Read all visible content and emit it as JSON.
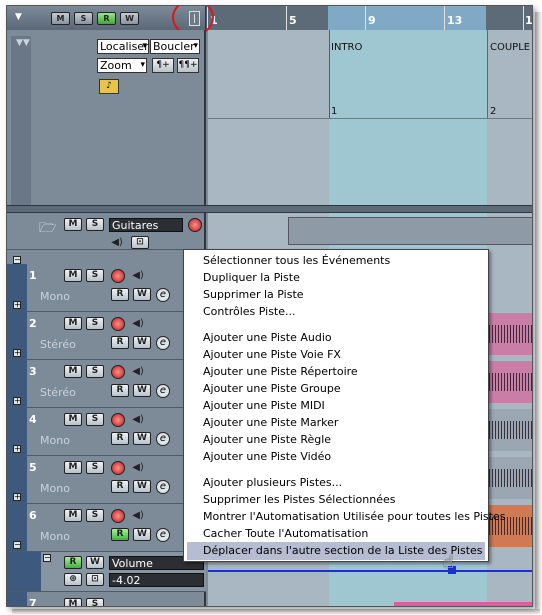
{
  "toolbar": {
    "buttons": [
      {
        "label": "M",
        "on": false
      },
      {
        "label": "S",
        "on": false
      },
      {
        "label": "R",
        "on": true
      },
      {
        "label": "W",
        "on": false
      }
    ]
  },
  "ruler": {
    "numbers": [
      "1",
      "5",
      "9",
      "13",
      "1"
    ]
  },
  "inspector": {
    "locate_label": "Localiser",
    "cycle_label": "Boucler",
    "zoom_label": "Zoom"
  },
  "markers": [
    {
      "name": "INTRO",
      "index": "1"
    },
    {
      "name": "COUPLE",
      "index": "2"
    }
  ],
  "folder_track": {
    "name": "Guitares"
  },
  "tracks": [
    {
      "number": "1",
      "type": "Mono"
    },
    {
      "number": "2",
      "type": "Stéréo"
    },
    {
      "number": "3",
      "type": "Stéréo"
    },
    {
      "number": "4",
      "type": "Mono"
    },
    {
      "number": "5",
      "type": "Mono"
    },
    {
      "number": "6",
      "type": "Mono"
    }
  ],
  "automation": {
    "param": "Volume",
    "value": "-4.02"
  },
  "last_track_number": "7",
  "context_menu": {
    "items": [
      "Sélectionner tous les Événements",
      "Dupliquer la Piste",
      "Supprimer la Piste",
      "Contrôles Piste...",
      "Ajouter une Piste Audio",
      "Ajouter une Piste Voie FX",
      "Ajouter une Piste Répertoire",
      "Ajouter une Piste Groupe",
      "Ajouter une Piste MIDI",
      "Ajouter une Piste Marker",
      "Ajouter une Piste Règle",
      "Ajouter une Piste Vidéo",
      "Ajouter plusieurs Pistes...",
      "Supprimer les Pistes Sélectionnées",
      "Montrer l'Automatisation Utilisée pour toutes les Pistes",
      "Cacher Toute l'Automatisation",
      "Déplacer dans l'autre section de la Liste des Pistes"
    ],
    "highlighted": "Déplacer dans l'autre section de la Liste des Pistes"
  },
  "colors": {
    "track_strip": "#3d5a7e",
    "cycle": "#9fc7d2",
    "annotation_circle": "#e01515",
    "audio_event": "#c97ea7",
    "menu_highlight": "#b6bdd2"
  }
}
